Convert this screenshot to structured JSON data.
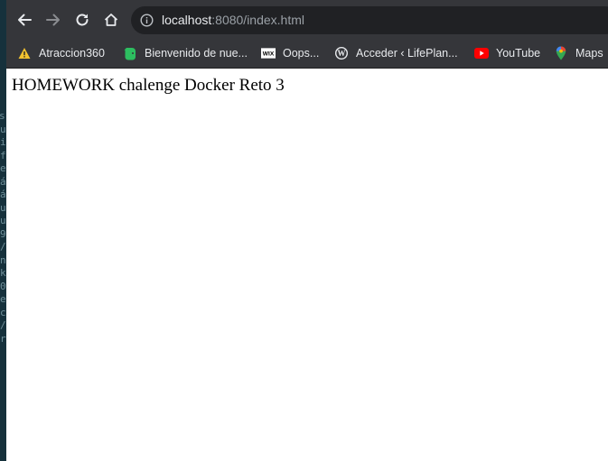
{
  "background_terminal": {
    "visible_glyphs": "s\nu\ni\nf\ne\ná\ná\nu\nu\n9\n/\nn\nk\n0\ne\nc\n/\nr"
  },
  "browser": {
    "toolbar": {
      "back_icon": "arrow-left-icon",
      "forward_icon": "arrow-right-icon",
      "reload_icon": "reload-icon",
      "home_icon": "home-icon",
      "address_host": "localhost",
      "address_rest": ":8080/index.html",
      "info_icon": "info-icon"
    },
    "bookmarks": [
      {
        "label": "Atraccion360",
        "icon": "warning-triangle-icon",
        "color": "#f2c230"
      },
      {
        "label": "Bienvenido de nue...",
        "icon": "evernote-icon",
        "color": "#2dbe60"
      },
      {
        "label": "Oops...",
        "icon": "wix-icon",
        "color": "#ffffff"
      },
      {
        "label": "Acceder ‹ LifePlan...",
        "icon": "wordpress-icon",
        "color": "#e8eaed"
      },
      {
        "label": "YouTube",
        "icon": "youtube-icon",
        "color": "#ff0000"
      },
      {
        "label": "Maps",
        "icon": "maps-pin-icon",
        "color": "#34a853"
      }
    ]
  },
  "page": {
    "text": "HOMEWORK chalenge Docker Reto 3"
  },
  "colors": {
    "chrome_dark": "#35363a",
    "omnibox": "#202124",
    "page_bg": "#ffffff"
  }
}
